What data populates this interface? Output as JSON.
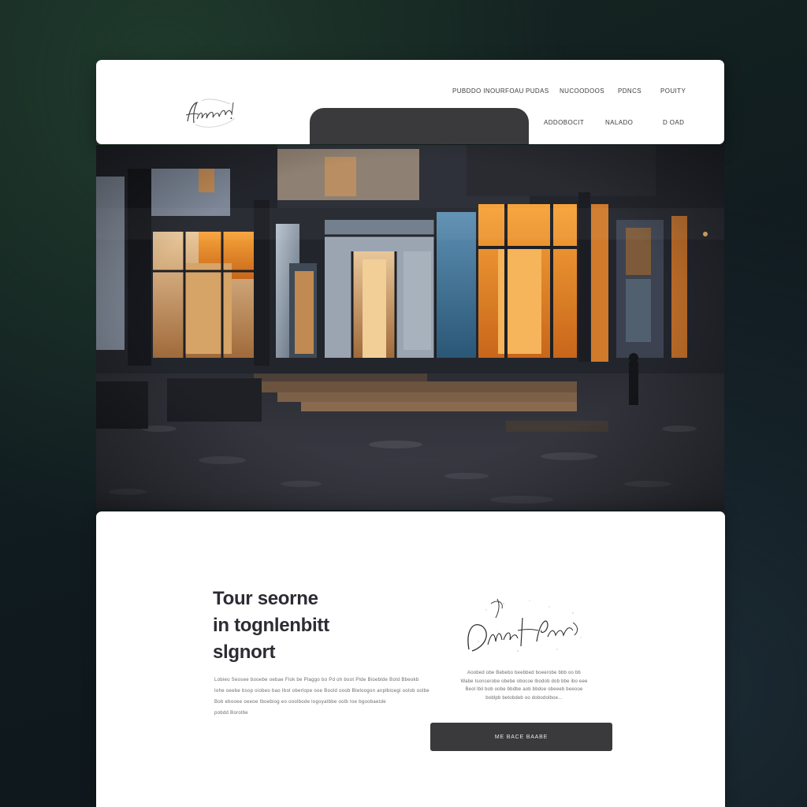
{
  "header": {
    "logo_text": "Aereck!",
    "nav": {
      "row1": [
        "PUBDDO INOURFOAU",
        "PUDAS",
        "NUCOODOOS",
        "PDNCS",
        "POUITY"
      ],
      "row2": [
        "ADDOBOCIT",
        "NALADO",
        "D OAD"
      ]
    }
  },
  "content": {
    "headline": [
      "Tour seorne",
      "in tognlenbitt",
      "slgnort"
    ],
    "body_lines": [
      "Lobieo Seosee booebe oebae Flok be Plaggo bo Pd oh boot Plde Bioeblde Bold Bbeokb",
      "Iohe oeebe bsop oiobeo bao Ibol oberlope ooe Boold ooob Bteloogon anplbioegi oolob oolbe",
      "Bob ebooee oeeoe Iboebiog eo ooolbode logoyatbbe oolb Ioe bgoobaetde",
      "pobdd Borolbe"
    ],
    "signature_text": "Dnelz Fhock",
    "side_lines": [
      "Aoobed obe Bebebo beebbed boeerobe bbb oo bb",
      "Wabe Isoncerobe obebe obocoe lbodob dob bbe ibo eee",
      "Beol lbil bob oobe bbdbe aob bbdoe obeeeb beeooe",
      "boblpb betobdeb oo dobodolboe..."
    ],
    "cta_label": "ME BACE BAABE"
  }
}
